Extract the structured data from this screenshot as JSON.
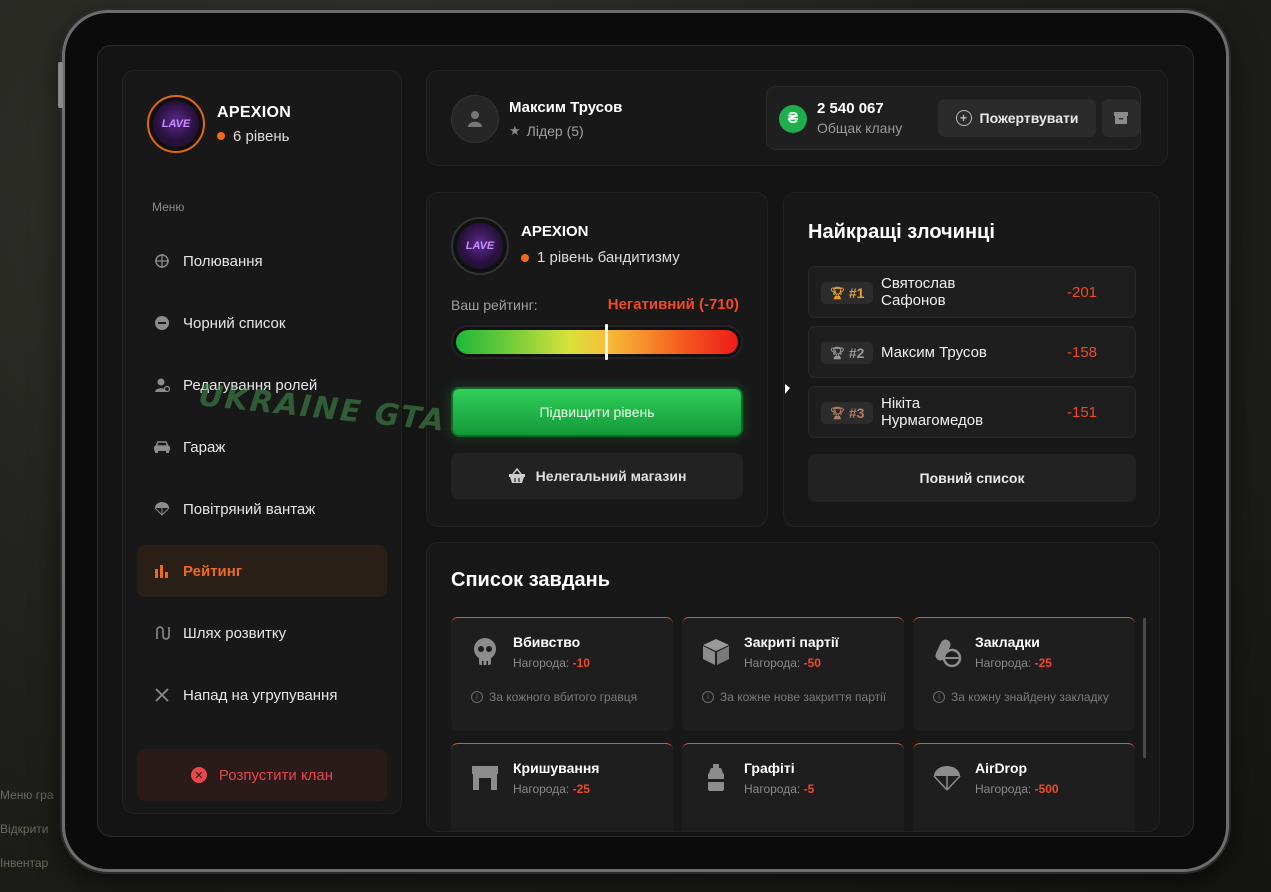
{
  "background": {
    "labels": [
      "Меню гра",
      "Відкрити",
      "Інвентар"
    ]
  },
  "clan": {
    "name": "APEXION",
    "level": "6 рівень",
    "logo_text": "LAVE"
  },
  "sidebar": {
    "menu_title": "Меню",
    "items": [
      {
        "label": "Полювання",
        "icon": "crosshair-icon",
        "active": false
      },
      {
        "label": "Чорний список",
        "icon": "minus-circle-icon",
        "active": false
      },
      {
        "label": "Редагування ролей",
        "icon": "user-gear-icon",
        "active": false
      },
      {
        "label": "Гараж",
        "icon": "car-icon",
        "active": false
      },
      {
        "label": "Повітряний вантаж",
        "icon": "parachute-icon",
        "active": false
      },
      {
        "label": "Рейтинг",
        "icon": "bar-chart-icon",
        "active": true
      },
      {
        "label": "Шлях розвитку",
        "icon": "path-icon",
        "active": false
      },
      {
        "label": "Напад на угрупування",
        "icon": "crossed-swords-icon",
        "active": false
      }
    ],
    "disband_label": "Розпустити клан"
  },
  "topbar": {
    "user_name": "Максим Трусов",
    "user_role": "Лідер (5)",
    "balance": "2 540 067",
    "balance_label": "Общак клану",
    "currency_symbol": "₴",
    "donate_label": "Пожертвувати"
  },
  "rating": {
    "clan_name": "APEXION",
    "level": "1 рівень бандитизму",
    "rating_label": "Ваш рейтинг:",
    "rating_value": "Негативний (-710)",
    "marker_fraction": 0.53,
    "upgrade_label": "Підвищити рівень",
    "shop_label": "Нелегальний магазин",
    "watermark": "UKRAINE GTA"
  },
  "criminals": {
    "title": "Найкращі злочинці",
    "rows": [
      {
        "rank": "#1",
        "name": "Святослав Сафонов",
        "score": "-201",
        "color": "#e8a030"
      },
      {
        "rank": "#2",
        "name": "Максим Трусов",
        "score": "-158",
        "color": "#9a9a9a"
      },
      {
        "rank": "#3",
        "name": "Нікіта Нурмагомедов",
        "score": "-151",
        "color": "#b08060"
      }
    ],
    "full_list_label": "Повний список"
  },
  "tasks": {
    "title": "Список завдань",
    "reward_label": "Нагорода:",
    "items": [
      {
        "name": "Вбивство",
        "reward": "-10",
        "note": "За кожного вбитого гравця",
        "icon": "skull-icon"
      },
      {
        "name": "Закриті партії",
        "reward": "-50",
        "note": "За кожне нове закриття партії",
        "icon": "box-icon"
      },
      {
        "name": "Закладки",
        "reward": "-25",
        "note": "За кожну знайдену закладку",
        "icon": "pills-icon"
      },
      {
        "name": "Кришування",
        "reward": "-25",
        "note": "",
        "icon": "shop-icon"
      },
      {
        "name": "Графіті",
        "reward": "-5",
        "note": "",
        "icon": "spray-can-icon"
      },
      {
        "name": "AirDrop",
        "reward": "-500",
        "note": "",
        "icon": "parachute-icon"
      }
    ]
  },
  "colors": {
    "accent": "#ef6a1a",
    "negative": "#ef4a2a",
    "success": "#1fae4c"
  }
}
